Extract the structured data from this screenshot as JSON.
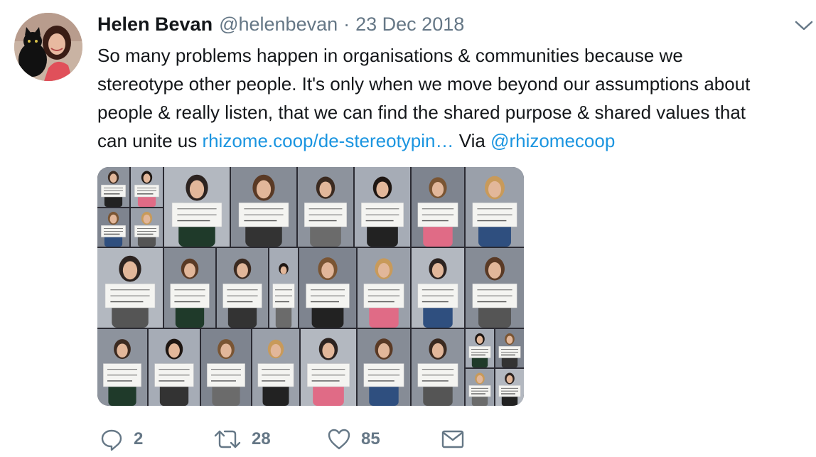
{
  "tweet": {
    "author_name": "Helen Bevan",
    "handle": "@helenbevan",
    "separator": "·",
    "date": "23 Dec 2018",
    "text_lines": [
      "So many problems happen in organisations & communities because we",
      "stereotype other people. It's only when we move beyond our assumptions about",
      "people & really listen, that we can find the shared purpose & shared values that"
    ],
    "last_line_prefix": "can unite us ",
    "link_text": "rhizome.coop/de-stereotypin…",
    "via_text": " Via ",
    "mention": "@rhizomecoop"
  },
  "media": {
    "alt": "Photo collage of people holding hand-written signs",
    "sign_texts": [
      "TROUBLE-MAKER",
      "ANOREXIC",
      "NAIVE",
      "RICH",
      "EASY",
      "FAT",
      "SNOB",
      "EMO/GOTH",
      "STUPID",
      "FREE"
    ]
  },
  "actions": {
    "reply_count": "2",
    "retweet_count": "28",
    "like_count": "85"
  },
  "icons": {
    "reply": "comment-bubble-icon",
    "retweet": "retweet-arrows-icon",
    "like": "heart-icon",
    "dm": "envelope-icon",
    "caret": "chevron-down-icon"
  },
  "colors": {
    "link": "#1b95e0",
    "muted": "#657786",
    "text": "#14171a"
  }
}
